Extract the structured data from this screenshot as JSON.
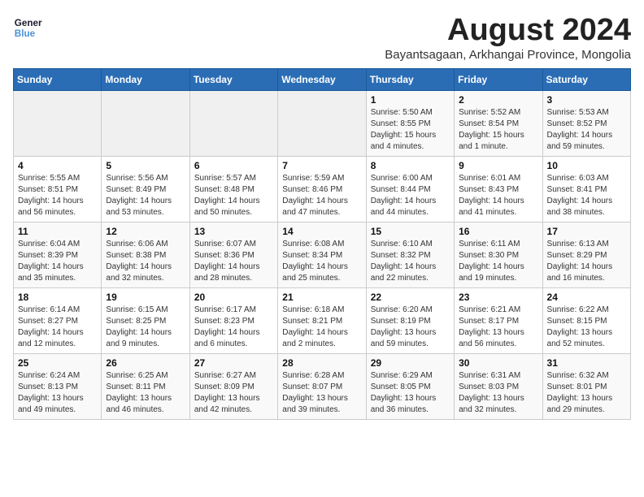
{
  "logo": {
    "line1": "General",
    "line2": "Blue"
  },
  "title": "August 2024",
  "subtitle": "Bayantsagaan, Arkhangai Province, Mongolia",
  "days_of_week": [
    "Sunday",
    "Monday",
    "Tuesday",
    "Wednesday",
    "Thursday",
    "Friday",
    "Saturday"
  ],
  "weeks": [
    [
      {
        "day": "",
        "info": ""
      },
      {
        "day": "",
        "info": ""
      },
      {
        "day": "",
        "info": ""
      },
      {
        "day": "",
        "info": ""
      },
      {
        "day": "1",
        "info": "Sunrise: 5:50 AM\nSunset: 8:55 PM\nDaylight: 15 hours\nand 4 minutes."
      },
      {
        "day": "2",
        "info": "Sunrise: 5:52 AM\nSunset: 8:54 PM\nDaylight: 15 hours\nand 1 minute."
      },
      {
        "day": "3",
        "info": "Sunrise: 5:53 AM\nSunset: 8:52 PM\nDaylight: 14 hours\nand 59 minutes."
      }
    ],
    [
      {
        "day": "4",
        "info": "Sunrise: 5:55 AM\nSunset: 8:51 PM\nDaylight: 14 hours\nand 56 minutes."
      },
      {
        "day": "5",
        "info": "Sunrise: 5:56 AM\nSunset: 8:49 PM\nDaylight: 14 hours\nand 53 minutes."
      },
      {
        "day": "6",
        "info": "Sunrise: 5:57 AM\nSunset: 8:48 PM\nDaylight: 14 hours\nand 50 minutes."
      },
      {
        "day": "7",
        "info": "Sunrise: 5:59 AM\nSunset: 8:46 PM\nDaylight: 14 hours\nand 47 minutes."
      },
      {
        "day": "8",
        "info": "Sunrise: 6:00 AM\nSunset: 8:44 PM\nDaylight: 14 hours\nand 44 minutes."
      },
      {
        "day": "9",
        "info": "Sunrise: 6:01 AM\nSunset: 8:43 PM\nDaylight: 14 hours\nand 41 minutes."
      },
      {
        "day": "10",
        "info": "Sunrise: 6:03 AM\nSunset: 8:41 PM\nDaylight: 14 hours\nand 38 minutes."
      }
    ],
    [
      {
        "day": "11",
        "info": "Sunrise: 6:04 AM\nSunset: 8:39 PM\nDaylight: 14 hours\nand 35 minutes."
      },
      {
        "day": "12",
        "info": "Sunrise: 6:06 AM\nSunset: 8:38 PM\nDaylight: 14 hours\nand 32 minutes."
      },
      {
        "day": "13",
        "info": "Sunrise: 6:07 AM\nSunset: 8:36 PM\nDaylight: 14 hours\nand 28 minutes."
      },
      {
        "day": "14",
        "info": "Sunrise: 6:08 AM\nSunset: 8:34 PM\nDaylight: 14 hours\nand 25 minutes."
      },
      {
        "day": "15",
        "info": "Sunrise: 6:10 AM\nSunset: 8:32 PM\nDaylight: 14 hours\nand 22 minutes."
      },
      {
        "day": "16",
        "info": "Sunrise: 6:11 AM\nSunset: 8:30 PM\nDaylight: 14 hours\nand 19 minutes."
      },
      {
        "day": "17",
        "info": "Sunrise: 6:13 AM\nSunset: 8:29 PM\nDaylight: 14 hours\nand 16 minutes."
      }
    ],
    [
      {
        "day": "18",
        "info": "Sunrise: 6:14 AM\nSunset: 8:27 PM\nDaylight: 14 hours\nand 12 minutes."
      },
      {
        "day": "19",
        "info": "Sunrise: 6:15 AM\nSunset: 8:25 PM\nDaylight: 14 hours\nand 9 minutes."
      },
      {
        "day": "20",
        "info": "Sunrise: 6:17 AM\nSunset: 8:23 PM\nDaylight: 14 hours\nand 6 minutes."
      },
      {
        "day": "21",
        "info": "Sunrise: 6:18 AM\nSunset: 8:21 PM\nDaylight: 14 hours\nand 2 minutes."
      },
      {
        "day": "22",
        "info": "Sunrise: 6:20 AM\nSunset: 8:19 PM\nDaylight: 13 hours\nand 59 minutes."
      },
      {
        "day": "23",
        "info": "Sunrise: 6:21 AM\nSunset: 8:17 PM\nDaylight: 13 hours\nand 56 minutes."
      },
      {
        "day": "24",
        "info": "Sunrise: 6:22 AM\nSunset: 8:15 PM\nDaylight: 13 hours\nand 52 minutes."
      }
    ],
    [
      {
        "day": "25",
        "info": "Sunrise: 6:24 AM\nSunset: 8:13 PM\nDaylight: 13 hours\nand 49 minutes."
      },
      {
        "day": "26",
        "info": "Sunrise: 6:25 AM\nSunset: 8:11 PM\nDaylight: 13 hours\nand 46 minutes."
      },
      {
        "day": "27",
        "info": "Sunrise: 6:27 AM\nSunset: 8:09 PM\nDaylight: 13 hours\nand 42 minutes."
      },
      {
        "day": "28",
        "info": "Sunrise: 6:28 AM\nSunset: 8:07 PM\nDaylight: 13 hours\nand 39 minutes."
      },
      {
        "day": "29",
        "info": "Sunrise: 6:29 AM\nSunset: 8:05 PM\nDaylight: 13 hours\nand 36 minutes."
      },
      {
        "day": "30",
        "info": "Sunrise: 6:31 AM\nSunset: 8:03 PM\nDaylight: 13 hours\nand 32 minutes."
      },
      {
        "day": "31",
        "info": "Sunrise: 6:32 AM\nSunset: 8:01 PM\nDaylight: 13 hours\nand 29 minutes."
      }
    ]
  ]
}
